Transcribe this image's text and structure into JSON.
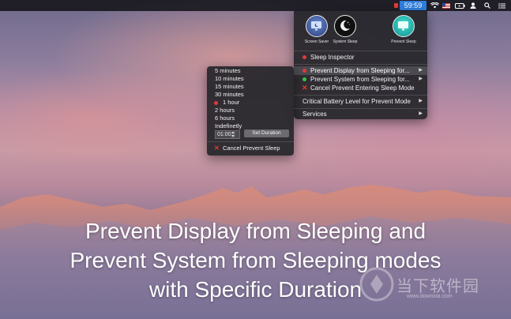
{
  "menubar": {
    "time": "59:59",
    "icons": [
      "indicator-icon",
      "wifi-icon",
      "flag-icon",
      "battery-icon",
      "user-icon",
      "spotlight-icon",
      "notification-list-icon"
    ]
  },
  "menu": {
    "buttons": [
      {
        "name": "screen-saver",
        "label": "Screen Saver"
      },
      {
        "name": "system-sleep",
        "label": "System Sleep"
      },
      {
        "name": "prevent-sleep",
        "label": "Prevent Sleep"
      }
    ],
    "items": {
      "sleep_inspector": "Sleep Inspector",
      "prevent_display": "Prevent Display from Sleeping for...",
      "prevent_system": "Prevent System from Sleeping for...",
      "cancel_prevent": "Cancel Prevent Entering Sleep Mode",
      "critical_battery": "Critical Battery Level for Prevent Mode",
      "services": "Services"
    }
  },
  "submenu": {
    "durations": [
      "5 minutes",
      "10 minutes",
      "15 minutes",
      "30 minutes",
      "1 hour",
      "2 hours",
      "6 hours",
      "Indefinetly"
    ],
    "selected": "1 hour",
    "time_value": "01:00",
    "set_duration": "Set Duration",
    "cancel": "Cancel Prevent Sleep"
  },
  "caption": {
    "line1": "Prevent Display from Sleeping and",
    "line2": "Prevent System from Sleeping modes",
    "line3": "with Specific Duration"
  },
  "watermark": {
    "text": "当下软件园",
    "url": "www.downxia.com"
  },
  "colors": {
    "menubar": "#14141a",
    "time_badge": "#2f7fe0",
    "menu_bg": "#26262a",
    "highlight": "#4a4a50",
    "red_dot": "#e23b3b",
    "green_dot": "#3ec44b",
    "cancel_x": "#e8392f"
  }
}
